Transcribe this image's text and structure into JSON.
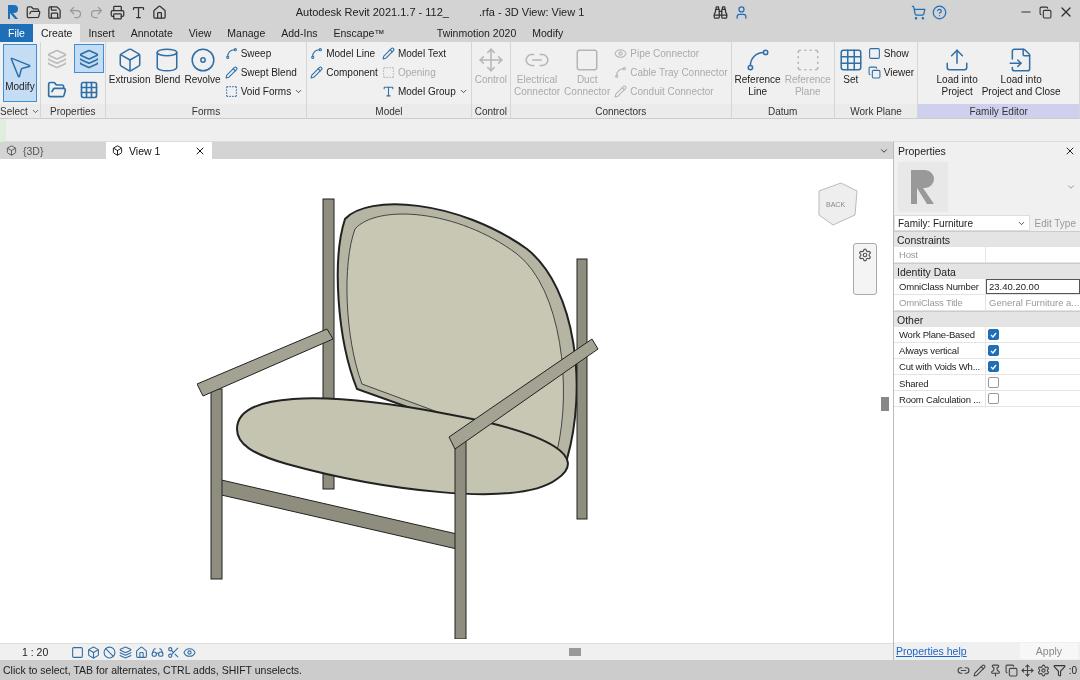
{
  "window": {
    "title": [
      "Autodesk Revit 2021.1.7 - 112_",
      ".rfa - 3D View: View 1"
    ]
  },
  "ribbon_tabs": [
    {
      "label": "File",
      "kind": "application",
      "selected": false
    },
    {
      "label": "Create",
      "kind": "tab",
      "selected": true
    },
    {
      "label": "Insert",
      "kind": "tab",
      "selected": false
    },
    {
      "label": "Annotate",
      "kind": "tab",
      "selected": false
    },
    {
      "label": "View",
      "kind": "tab",
      "selected": false
    },
    {
      "label": "Manage",
      "kind": "tab",
      "selected": false
    },
    {
      "label": "Add-Ins",
      "kind": "tab",
      "selected": false
    },
    {
      "label": "Enscape™",
      "kind": "tab",
      "selected": false
    },
    {
      "label": "Twinmotion 2020",
      "kind": "tab",
      "selected": false
    },
    {
      "label": "Modify",
      "kind": "tab",
      "selected": false
    }
  ],
  "panels": [
    {
      "name": "Select",
      "dropdown": true,
      "highlighted": false,
      "tools": [
        {
          "kind": "large",
          "label": "Modify",
          "selected": true,
          "disabled": false
        }
      ]
    },
    {
      "name": "Properties",
      "dropdown": false,
      "highlighted": false,
      "tools": [
        {
          "kind": "icons",
          "items": [
            {
              "selected": false,
              "disabled": true
            },
            {
              "selected": true,
              "disabled": false
            },
            {
              "selected": false,
              "disabled": false
            },
            {
              "selected": false,
              "disabled": false
            }
          ]
        }
      ]
    },
    {
      "name": "Forms",
      "dropdown": false,
      "highlighted": false,
      "tools": [
        {
          "kind": "large",
          "label": "Extrusion",
          "selected": false,
          "disabled": false
        },
        {
          "kind": "large",
          "label": "Blend",
          "selected": false,
          "disabled": false
        },
        {
          "kind": "large",
          "label": "Revolve",
          "selected": false,
          "disabled": false
        },
        {
          "kind": "column",
          "items": [
            {
              "label": "Sweep",
              "dropdown": false,
              "disabled": false
            },
            {
              "label": "Swept Blend",
              "dropdown": false,
              "disabled": false
            },
            {
              "label": "Void Forms",
              "dropdown": true,
              "disabled": false
            }
          ]
        }
      ]
    },
    {
      "name": "Model",
      "dropdown": false,
      "highlighted": false,
      "tools": [
        {
          "kind": "column",
          "items": [
            {
              "label": "Model Line",
              "dropdown": false,
              "disabled": false
            },
            {
              "label": "Component",
              "dropdown": false,
              "disabled": false
            }
          ]
        },
        {
          "kind": "column",
          "items": [
            {
              "label": "Model Text",
              "dropdown": false,
              "disabled": false
            },
            {
              "label": "Opening",
              "dropdown": false,
              "disabled": true
            },
            {
              "label": "Model Group",
              "dropdown": true,
              "disabled": false
            }
          ]
        }
      ]
    },
    {
      "name": "Control",
      "dropdown": false,
      "highlighted": false,
      "tools": [
        {
          "kind": "large",
          "label": "Control",
          "selected": false,
          "disabled": true
        }
      ]
    },
    {
      "name": "Connectors",
      "dropdown": false,
      "highlighted": false,
      "tools": [
        {
          "kind": "large",
          "label": "Electrical\nConnector",
          "selected": false,
          "disabled": true
        },
        {
          "kind": "large",
          "label": "Duct\nConnector",
          "selected": false,
          "disabled": true
        },
        {
          "kind": "column",
          "items": [
            {
              "label": "Pipe Connector",
              "dropdown": false,
              "disabled": true
            },
            {
              "label": "Cable Tray Connector",
              "dropdown": false,
              "disabled": true
            },
            {
              "label": "Conduit Connector",
              "dropdown": false,
              "disabled": true
            }
          ]
        }
      ]
    },
    {
      "name": "Datum",
      "dropdown": false,
      "highlighted": false,
      "tools": [
        {
          "kind": "large",
          "label": "Reference\nLine",
          "selected": false,
          "disabled": false
        },
        {
          "kind": "large",
          "label": "Reference\nPlane",
          "selected": false,
          "disabled": true
        }
      ]
    },
    {
      "name": "Work Plane",
      "dropdown": false,
      "highlighted": false,
      "tools": [
        {
          "kind": "large",
          "label": "Set",
          "selected": false,
          "disabled": false
        },
        {
          "kind": "column",
          "items": [
            {
              "label": "Show",
              "dropdown": false,
              "disabled": false
            },
            {
              "label": "Viewer",
              "dropdown": false,
              "disabled": false
            }
          ]
        }
      ]
    },
    {
      "name": "Family Editor",
      "dropdown": false,
      "highlighted": true,
      "tools": [
        {
          "kind": "large",
          "label": "Load into\nProject",
          "selected": false,
          "disabled": false
        },
        {
          "kind": "large",
          "label": "Load into\nProject and Close",
          "selected": false,
          "disabled": false
        }
      ]
    }
  ],
  "view_tabs": [
    {
      "label": "{3D}",
      "selected": false
    },
    {
      "label": "View 1",
      "selected": true
    }
  ],
  "view_cube": {
    "label": "BACK"
  },
  "view_bar": {
    "scale": "1 : 20"
  },
  "properties": {
    "title": "Properties",
    "type_selector": "Family: Furniture",
    "edit_type": "Edit Type",
    "groups": [
      {
        "name": "Constraints",
        "rows": [
          {
            "kind": "text",
            "label": "Host",
            "disabled": true,
            "editable": false
          }
        ]
      },
      {
        "name": "Identity Data",
        "rows": [
          {
            "kind": "text",
            "label": "OmniClass Number",
            "value": "23.40.20.00",
            "disabled": false,
            "editable": true
          },
          {
            "kind": "text",
            "label": "OmniClass Title",
            "value": "General Furniture a...",
            "disabled": true,
            "editable": false
          }
        ]
      },
      {
        "name": "Other",
        "rows": [
          {
            "kind": "checkbox",
            "label": "Work Plane-Based",
            "checked": true
          },
          {
            "kind": "checkbox",
            "label": "Always vertical",
            "checked": true
          },
          {
            "kind": "checkbox",
            "label": "Cut with Voids Wh...",
            "checked": true
          },
          {
            "kind": "checkbox",
            "label": "Shared",
            "checked": false
          },
          {
            "kind": "checkbox",
            "label": "Room Calculation ...",
            "checked": false
          }
        ]
      }
    ],
    "help_link": "Properties help",
    "apply": "Apply"
  },
  "status_bar": {
    "message": "Click to select, TAB for alternates, CTRL adds, SHIFT unselects.",
    "filter_count": ":0"
  }
}
